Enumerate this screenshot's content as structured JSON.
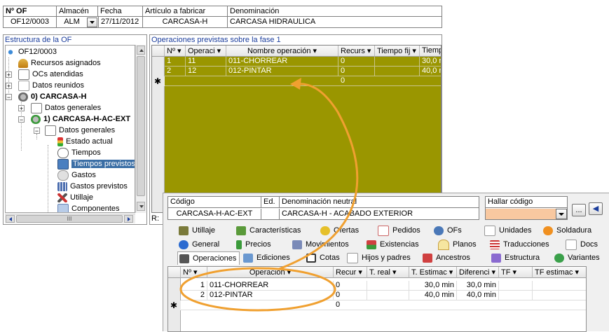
{
  "of_header": {
    "labels": [
      "Nº OF",
      "Almacén",
      "Fecha",
      "Artículo a fabricar",
      "Denominación"
    ],
    "values": [
      "OF12/0003",
      "ALM",
      "27/11/2012",
      "CARCASA-H",
      "CARCASA HIDRAULICA"
    ]
  },
  "tree": {
    "title": "Estructura de la OF",
    "items": [
      {
        "label": "OF12/0003",
        "icon": "share-icon"
      },
      {
        "label": "Recursos asignados",
        "icon": "user-icon"
      },
      {
        "label": "OCs atendidas",
        "icon": "document-icon"
      },
      {
        "label": "Datos reunidos",
        "icon": "folder-icon"
      },
      {
        "label": "0) CARCASA-H",
        "icon": "gear-icon"
      },
      {
        "label": "Datos generales",
        "icon": "document-icon"
      },
      {
        "label": "1) CARCASA-H-AC-EXT",
        "icon": "gear-icon"
      },
      {
        "label": "Datos generales",
        "icon": "document-icon"
      },
      {
        "label": "Estado actual",
        "icon": "traffic-light-icon"
      },
      {
        "label": "Tiempos",
        "icon": "clock-icon"
      },
      {
        "label": "Tiempos previstos",
        "icon": "calendar-clock-icon"
      },
      {
        "label": "Gastos",
        "icon": "coin-icon"
      },
      {
        "label": "Gastos previstos",
        "icon": "grid-icon"
      },
      {
        "label": "Utillaje",
        "icon": "tools-icon"
      },
      {
        "label": "Componentes",
        "icon": "components-icon"
      }
    ],
    "hscroll_glyph": "III"
  },
  "ops_top": {
    "title": "Operaciones previstas sobre la fase 1",
    "columns": [
      "Nº",
      "Operaci",
      "Nombre operación",
      "Recurs",
      "Tiempo fij",
      "Tiempo"
    ],
    "rows": [
      [
        "1",
        "11",
        "011-CHORREAR",
        "0",
        "",
        "30,0 m"
      ],
      [
        "2",
        "12",
        "012-PINTAR",
        "0",
        "",
        "40,0 m"
      ]
    ],
    "new_row_marker": "✱",
    "new_row_value": "0",
    "status_r": "R:"
  },
  "article": {
    "labels": {
      "code": "Código",
      "ed": "Ed.",
      "denom": "Denominación neutral",
      "find": "Hallar código"
    },
    "code": "CARCASA-H-AC-EXT",
    "ed": "",
    "denom": "CARCASA-H - ACABADO EXTERIOR",
    "find_value": "",
    "ellipsis_label": "...",
    "back_arrow": "◀"
  },
  "tabs": {
    "row1": [
      "Utillaje",
      "Características",
      "Ofertas",
      "Pedidos",
      "OFs",
      "Unidades",
      "Soldadura"
    ],
    "row2": [
      "General",
      "Precios",
      "Movimientos",
      "Existencias",
      "Planos",
      "Traducciones",
      "Docs"
    ],
    "row3": [
      "Operaciones",
      "Ediciones",
      "Cotas",
      "Hijos y padres",
      "Ancestros",
      "Estructura",
      "Variantes"
    ]
  },
  "ops_bottom": {
    "columns": [
      "Nº",
      "Operación",
      "Recur",
      "T. real",
      "T. Estimac",
      "Diferenci",
      "TF",
      "TF estimac"
    ],
    "rows": [
      [
        "1",
        "011-CHORREAR",
        "0",
        "",
        "30,0 min",
        "30,0 min",
        "",
        ""
      ],
      [
        "2",
        "012-PINTAR",
        "0",
        "",
        "40,0 min",
        "40,0 min",
        "",
        ""
      ]
    ],
    "new_row_marker": "✱",
    "new_row_value": "0"
  },
  "colors": {
    "olive": "#9a9600",
    "olive_sel": "#a9a622",
    "highlight": "#f0a030",
    "find_bg": "#f8c8a0",
    "tree_sel": "#3a6ea5"
  }
}
